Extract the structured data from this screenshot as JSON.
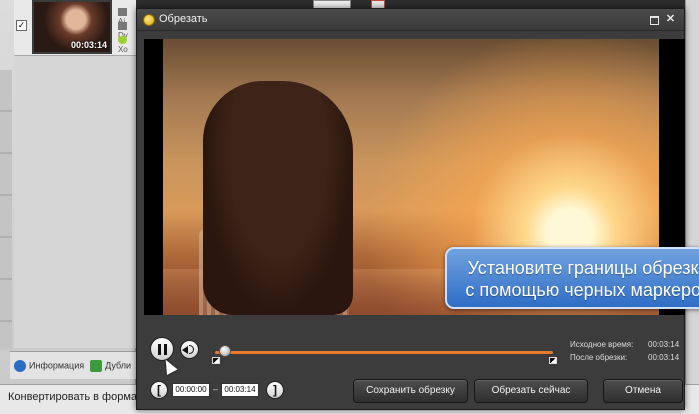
{
  "background_app": {
    "file_item": {
      "checked": true,
      "checkbox_mark": "✓",
      "thumbnail_time": "00:03:14",
      "meta_lines": [
        "Аі",
        "Dv",
        "Хо"
      ]
    },
    "tabs": [
      {
        "label": "Информация",
        "icon": "info-icon"
      },
      {
        "label": "Дубли",
        "icon": "subtitle-icon"
      }
    ],
    "format_label": "Конвертировать в формат:"
  },
  "dialog": {
    "title": "Обрезать",
    "icon": "scissors-icon",
    "window_buttons": {
      "maximize": "",
      "close": "✕"
    },
    "caption_line1": "Установите границы обрезки",
    "caption_line2": "с помощью черных маркеров",
    "player": {
      "play_state": "paused",
      "pause_icon": "pause-icon",
      "volume_icon": "volume-icon",
      "playhead_fraction": 0.02
    },
    "info": {
      "original_label": "Исходное время:",
      "original_value": "00:03:14",
      "cut_label": "После обрезки:",
      "cut_value": "00:03:14"
    },
    "range": {
      "start_bracket": "[",
      "end_bracket": "]",
      "start_time": "00:00:00",
      "separator": "–",
      "end_time": "00:03:14"
    },
    "buttons": {
      "save": "Сохранить обрезку",
      "cut_now": "Обрезать сейчас",
      "cancel": "Отмена"
    },
    "colors": {
      "accent": "#e8792c",
      "caption_bg": "#3d7ccc",
      "dialog_bg": "#3c3c3c"
    }
  }
}
